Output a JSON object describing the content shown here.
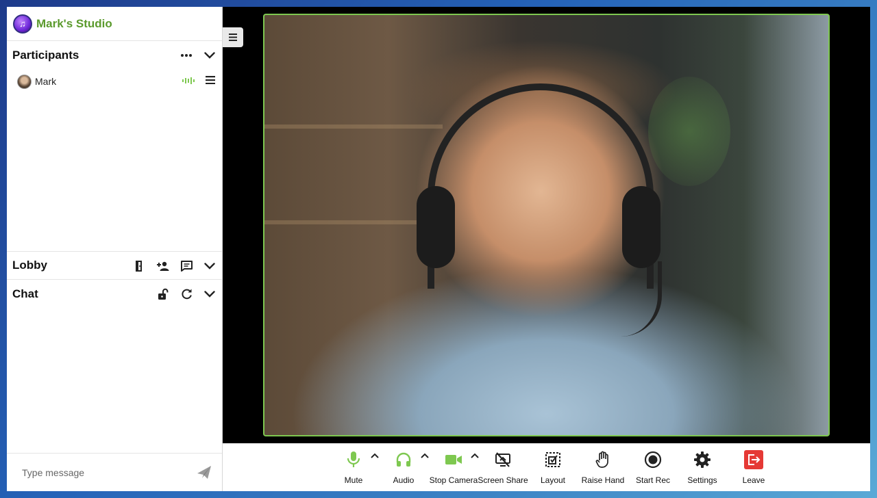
{
  "brand": {
    "title": "Mark's Studio"
  },
  "participants": {
    "title": "Participants",
    "items": [
      {
        "name": "Mark"
      }
    ]
  },
  "lobby": {
    "title": "Lobby"
  },
  "chat": {
    "title": "Chat",
    "placeholder": "Type message"
  },
  "toolbar": {
    "mute": "Mute",
    "audio": "Audio",
    "stop_camera": "Stop Camera",
    "screen_share": "Screen Share",
    "layout": "Layout",
    "raise_hand": "Raise Hand",
    "start_rec": "Start Rec",
    "settings": "Settings",
    "leave": "Leave"
  },
  "colors": {
    "accent": "#5b9a2d",
    "media_on": "#7ec850",
    "leave": "#e53935",
    "video_border": "#7ec850"
  },
  "icons": {
    "brand": "music-logo-icon",
    "participants_menu": "more-dots-icon",
    "collapse": "chevron-down-icon",
    "audio_level": "audio-level-icon",
    "participant_menu": "hamburger-icon",
    "lobby_door": "door-icon",
    "lobby_add": "add-person-icon",
    "lobby_message": "message-icon",
    "chat_lock": "unlock-icon",
    "chat_refresh": "refresh-icon",
    "send": "send-icon"
  }
}
